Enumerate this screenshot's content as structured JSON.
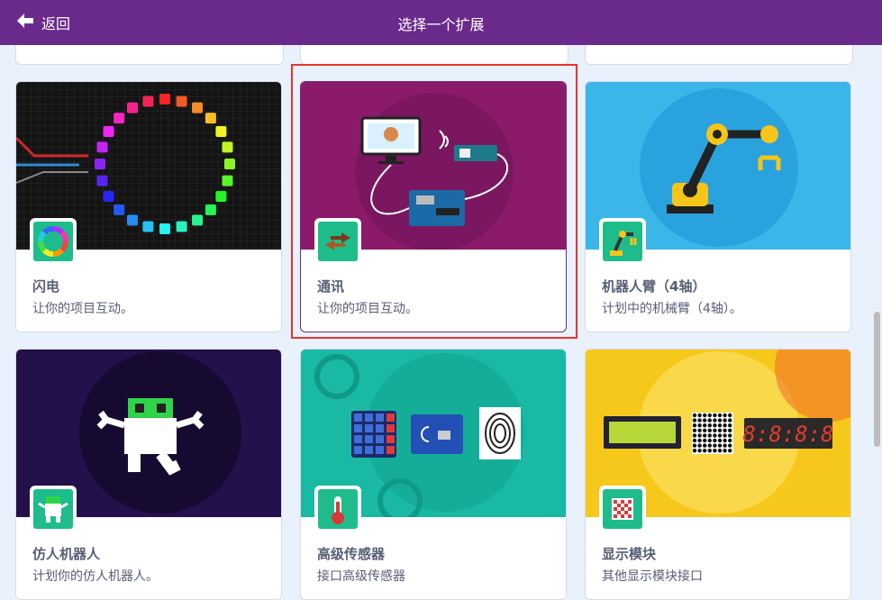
{
  "header": {
    "back_label": "返回",
    "title": "选择一个扩展"
  },
  "cards": [
    {
      "name": "闪电",
      "desc": "让你的项目互动。"
    },
    {
      "name": "通讯",
      "desc": "让你的项目互动。"
    },
    {
      "name": "机器人臂（4轴）",
      "desc": "计划中的机械臂（4轴）。"
    },
    {
      "name": "仿人机器人",
      "desc": "计划你的仿人机器人。"
    },
    {
      "name": "高级传感器",
      "desc": "接口高级传感器"
    },
    {
      "name": "显示模块",
      "desc": "其他显示模块接口"
    }
  ],
  "lcd_digits": "8:8:8:8",
  "colors": {
    "header": "#6a2a8c",
    "icon_bg": "#1ebc8a",
    "selection": "#e8342c",
    "text": "#575e75"
  }
}
